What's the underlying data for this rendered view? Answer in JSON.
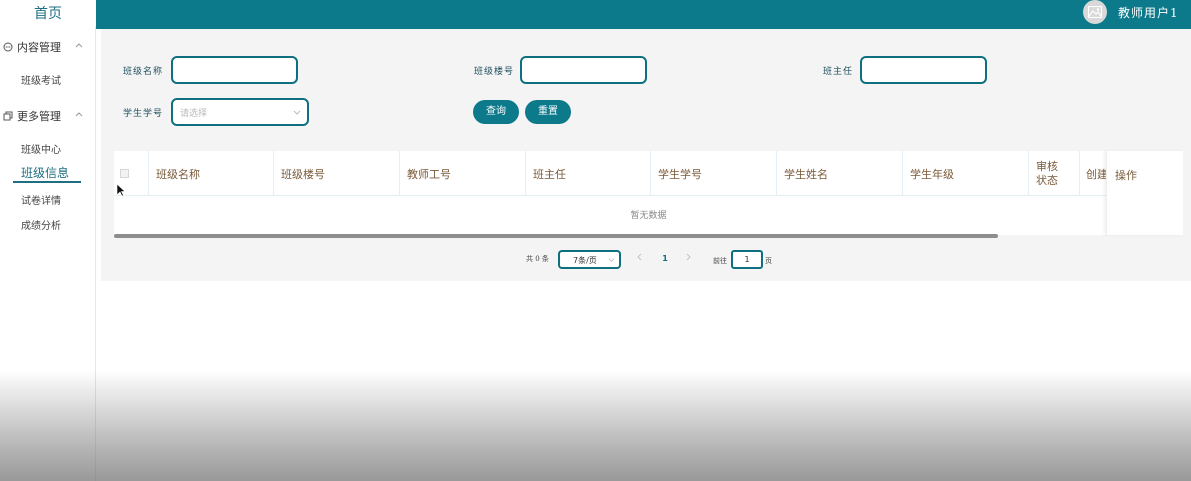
{
  "sidebar": {
    "brand": "首页",
    "groups": [
      {
        "label": "内容管理",
        "items": [
          "班级考试"
        ]
      },
      {
        "label": "更多管理",
        "items": [
          "班级中心",
          "班级信息",
          "试卷详情",
          "成绩分析"
        ]
      }
    ],
    "active_item": "班级信息"
  },
  "header": {
    "username": "教师用户1",
    "avatar_icon": "image-icon"
  },
  "search": {
    "class_name_label": "班级名称",
    "class_building_label": "班级楼号",
    "head_teacher_label": "班主任",
    "student_id_label": "学生学号",
    "student_id_placeholder": "请选择",
    "query_label": "查询",
    "reset_label": "重置"
  },
  "table": {
    "columns": [
      "班级名称",
      "班级楼号",
      "教师工号",
      "班主任",
      "学生学号",
      "学生姓名",
      "学生年级",
      "审核状态",
      "创建",
      "操作"
    ],
    "empty_text": "暂无数据"
  },
  "pagination": {
    "total_text": "共 0 条",
    "page_size": "7条/页",
    "current_page": "1",
    "goto_label": "前往",
    "goto_value": "1",
    "page_suffix": "页"
  },
  "colors": {
    "accent": "#0d7a8c",
    "header_text": "#7a5a3a"
  }
}
